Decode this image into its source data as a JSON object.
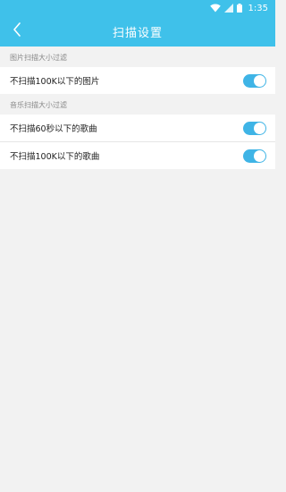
{
  "status_bar": {
    "time": "1:35",
    "icons": [
      "wifi-icon",
      "signal-icon",
      "battery-icon"
    ]
  },
  "header": {
    "title": "扫描设置",
    "back_icon": "chevron-left-icon"
  },
  "sections": [
    {
      "title": "图片扫描大小过滤",
      "items": [
        {
          "label": "不扫描100K以下的图片",
          "enabled": true
        }
      ]
    },
    {
      "title": "音乐扫描大小过滤",
      "items": [
        {
          "label": "不扫描60秒以下的歌曲",
          "enabled": true
        },
        {
          "label": "不扫描100K以下的歌曲",
          "enabled": true
        }
      ]
    }
  ],
  "colors": {
    "accent": "#3fc1ea",
    "toggle_on": "#3fb4e6",
    "background": "#f2f2f2"
  }
}
